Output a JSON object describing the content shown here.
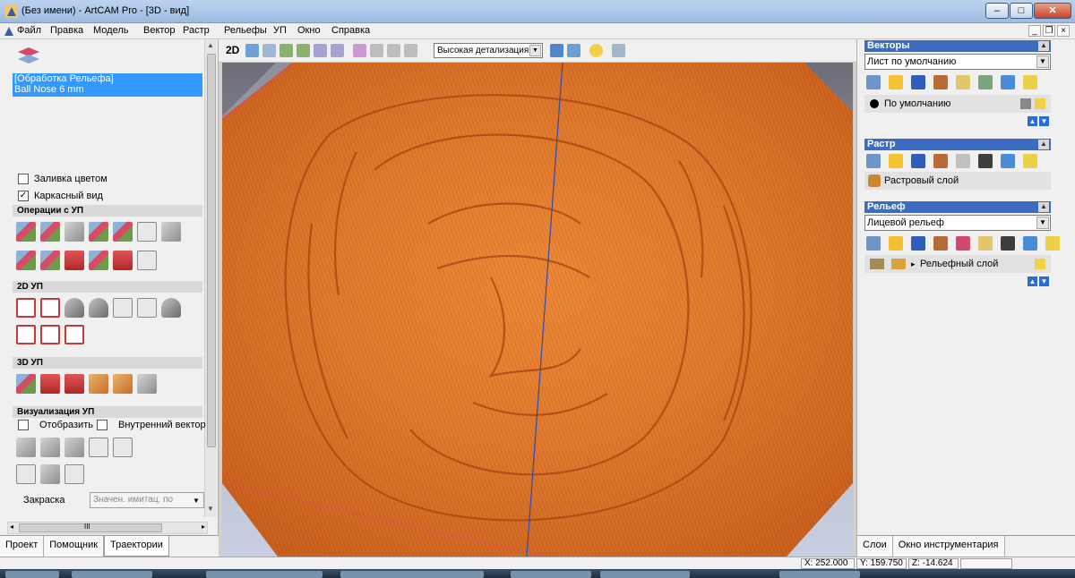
{
  "window": {
    "title": "(Без имени) - ArtCAM Pro - [3D - вид]"
  },
  "menu": [
    {
      "label": "Файл"
    },
    {
      "label": "Правка"
    },
    {
      "label": "Модель"
    },
    {
      "label": "Вектор"
    },
    {
      "label": "Растр"
    },
    {
      "label": "Рельефы"
    },
    {
      "label": "УП"
    },
    {
      "label": "Окно"
    },
    {
      "label": "Справка"
    }
  ],
  "left_panel": {
    "toolpath_list": {
      "title": "[Обработка Рельефа]",
      "tool": "Ball Nose 6 mm"
    },
    "fill_color_label": "Заливка цветом",
    "wireframe_label": "Каркасный вид",
    "sections": {
      "toolpath_ops": "Операции с УП",
      "toolpaths_2d": "2D УП",
      "toolpaths_3d": "3D УП",
      "visualization": "Визуализация УП"
    },
    "display_label": "Отобразить",
    "inner_vector_label": "Внутренний вектор",
    "shading_label": "Закраска",
    "shading_value": "Значен. имитац. по",
    "tabs": [
      "Проект",
      "Помощник",
      "Траектории"
    ],
    "scroll_glyph": "III"
  },
  "view_toolbar": {
    "mode_2d": "2D",
    "detail_level": "Высокая детализация"
  },
  "right_panel": {
    "vectors": {
      "title": "Векторы",
      "sheet": "Лист по умолчанию",
      "layer": "По умолчанию"
    },
    "bitmap": {
      "title": "Растр",
      "layer": "Растровый слой"
    },
    "relief": {
      "title": "Рельеф",
      "selection": "Лицевой рельеф",
      "layer": "Рельефный слой"
    },
    "tabs": [
      "Слои",
      "Окно инструментария"
    ]
  },
  "status": {
    "x": "X: 252.000",
    "y": "Y: 159.750",
    "z": "Z: -14.624"
  }
}
